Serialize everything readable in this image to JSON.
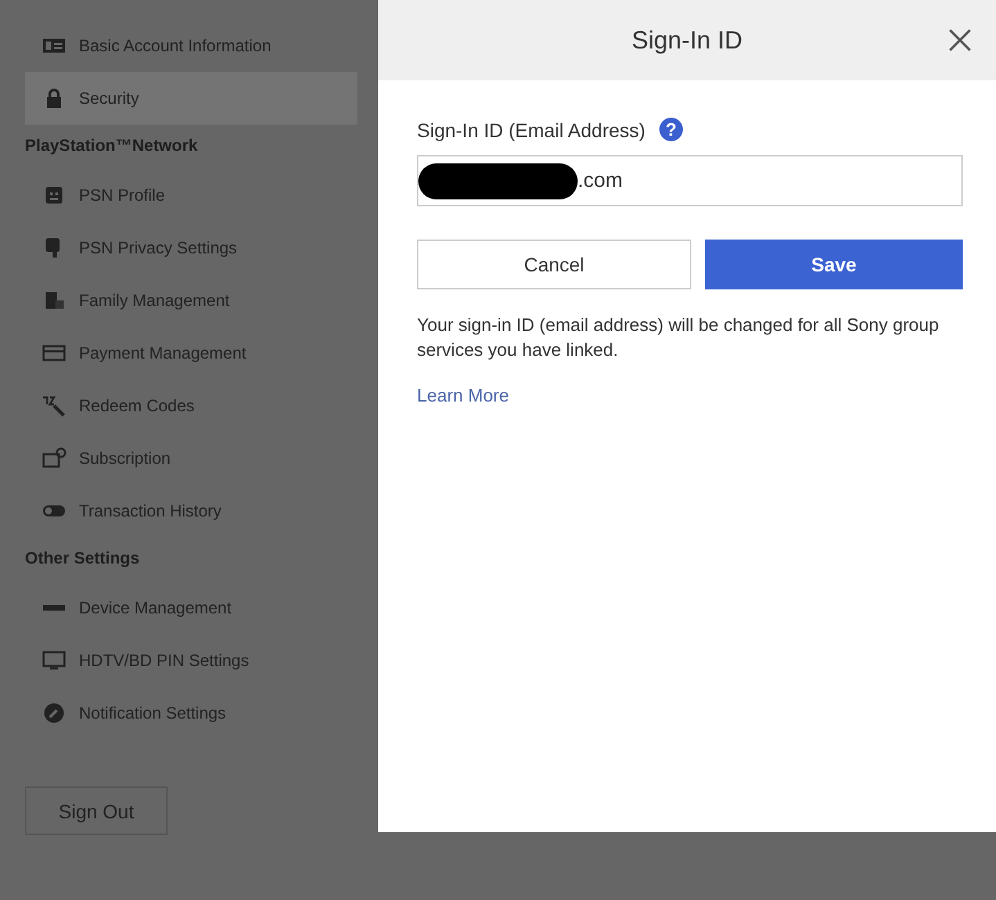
{
  "sidebar": {
    "sections": [
      {
        "items": [
          {
            "label": "Basic Account Information",
            "selected": false
          },
          {
            "label": "Security",
            "selected": true
          }
        ]
      },
      {
        "heading": "PlayStation™Network",
        "items": [
          {
            "label": "PSN Profile",
            "selected": false
          },
          {
            "label": "PSN Privacy Settings",
            "selected": false
          },
          {
            "label": "Family Management",
            "selected": false
          },
          {
            "label": "Payment Management",
            "selected": false
          },
          {
            "label": "Redeem Codes",
            "selected": false
          },
          {
            "label": "Subscription",
            "selected": false
          },
          {
            "label": "Transaction History",
            "selected": false
          }
        ]
      },
      {
        "heading": "Other Settings",
        "items": [
          {
            "label": "Device Management",
            "selected": false
          },
          {
            "label": "HDTV/BD PIN Settings",
            "selected": false
          },
          {
            "label": "Notification Settings",
            "selected": false
          }
        ]
      }
    ],
    "sign_out": "Sign Out"
  },
  "dialog": {
    "title": "Sign-In ID",
    "field_label": "Sign-In ID (Email Address)",
    "help": "?",
    "email_value": ".com",
    "buttons": {
      "cancel": "Cancel",
      "save": "Save"
    },
    "note": "Your sign-in ID (email address) will be changed for all Sony group services you have linked.",
    "link": "Learn More"
  }
}
